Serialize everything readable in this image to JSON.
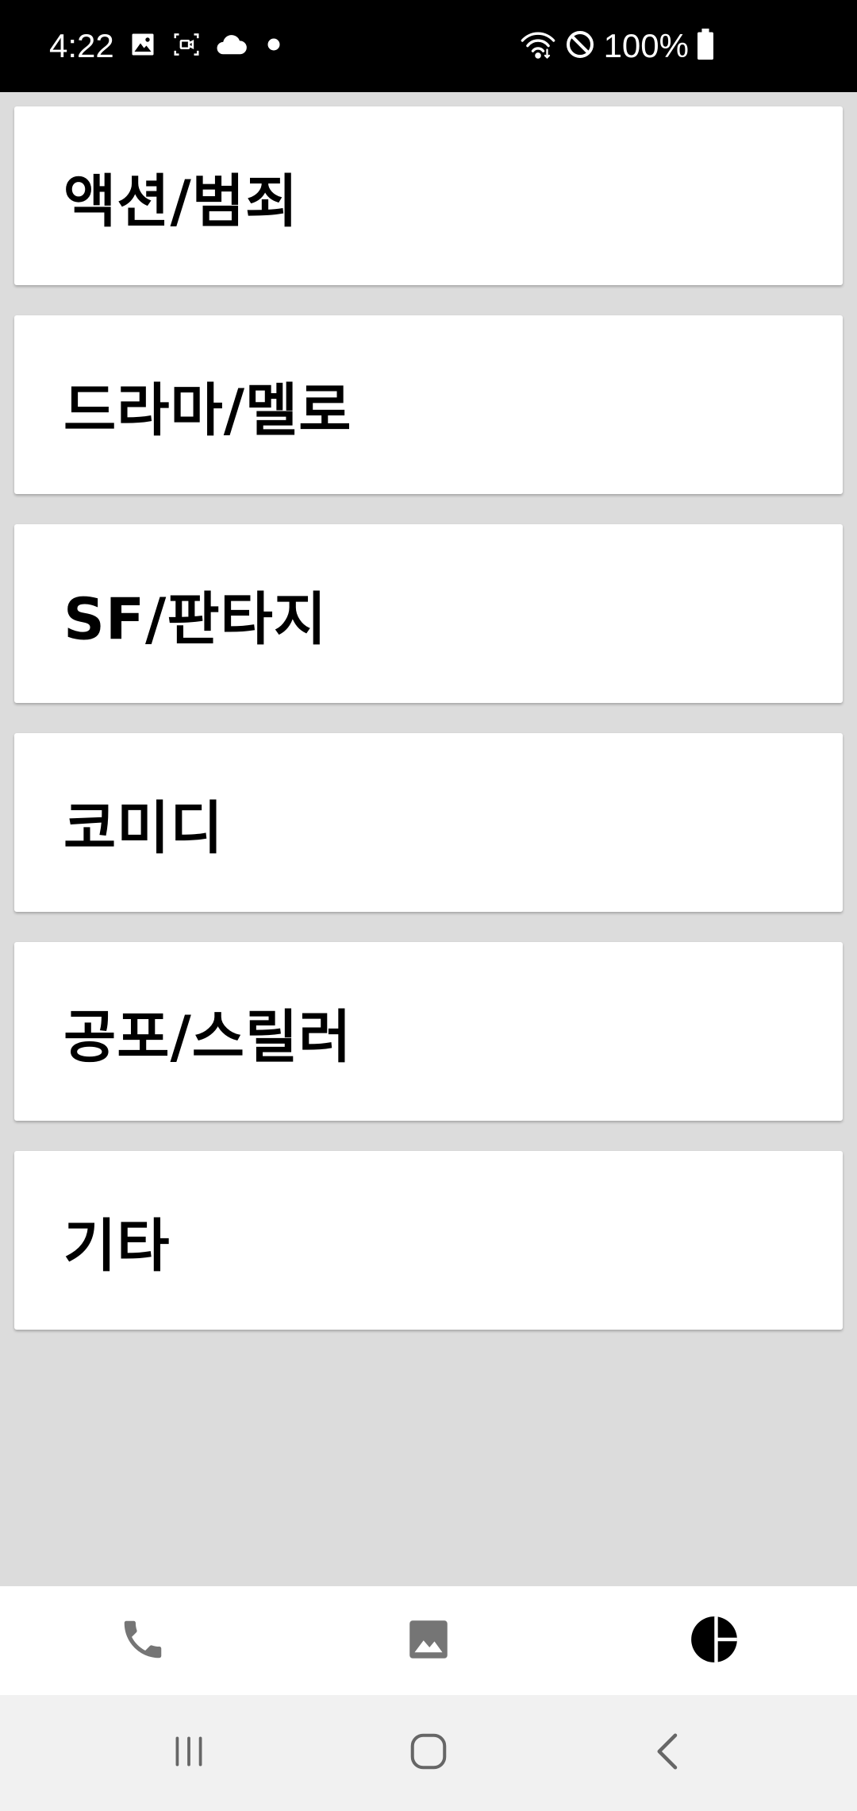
{
  "status_bar": {
    "time": "4:22",
    "battery_percent": "100%",
    "left_icons": [
      "image-icon",
      "screen-record-icon",
      "cloud-icon",
      "dot-icon"
    ],
    "right_icons": [
      "wifi-icon",
      "do-not-disturb-icon",
      "battery-icon"
    ]
  },
  "genres": [
    {
      "label": "액션/범죄"
    },
    {
      "label": "드라마/멜로"
    },
    {
      "label": "SF/판타지"
    },
    {
      "label": "코미디"
    },
    {
      "label": "공포/스릴러"
    },
    {
      "label": "기타"
    }
  ],
  "bottom_nav": {
    "items": [
      {
        "icon": "phone-icon"
      },
      {
        "icon": "image-icon"
      },
      {
        "icon": "pie-chart-icon"
      }
    ]
  },
  "system_nav": {
    "items": [
      {
        "icon": "recent-apps-icon"
      },
      {
        "icon": "home-icon"
      },
      {
        "icon": "back-icon"
      }
    ]
  },
  "colors": {
    "background": "#dcdcdc",
    "card": "#ffffff",
    "status_bar": "#000000",
    "system_nav": "#f1f1f1"
  }
}
